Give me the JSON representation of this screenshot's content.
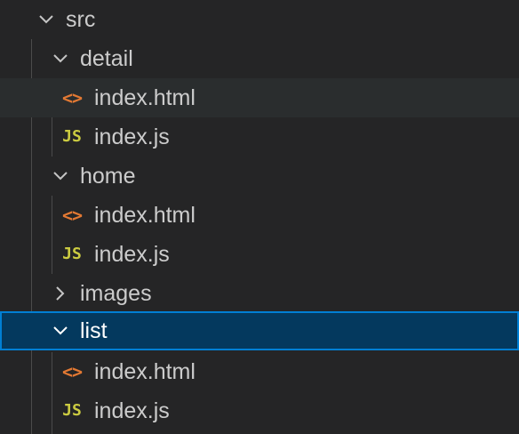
{
  "explorer": {
    "rows": [
      {
        "label": "src",
        "type": "folder",
        "expanded": true
      },
      {
        "label": "detail",
        "type": "folder",
        "expanded": true
      },
      {
        "label": "index.html",
        "type": "file",
        "icon": "<>",
        "icon_name": "html-file-icon"
      },
      {
        "label": "index.js",
        "type": "file",
        "icon": "JS",
        "icon_name": "js-file-icon"
      },
      {
        "label": "home",
        "type": "folder",
        "expanded": true
      },
      {
        "label": "index.html",
        "type": "file",
        "icon": "<>",
        "icon_name": "html-file-icon"
      },
      {
        "label": "index.js",
        "type": "file",
        "icon": "JS",
        "icon_name": "js-file-icon"
      },
      {
        "label": "images",
        "type": "folder",
        "expanded": false
      },
      {
        "label": "list",
        "type": "folder",
        "expanded": true,
        "selected": true
      },
      {
        "label": "index.html",
        "type": "file",
        "icon": "<>",
        "icon_name": "html-file-icon"
      },
      {
        "label": "index.js",
        "type": "file",
        "icon": "JS",
        "icon_name": "js-file-icon"
      }
    ]
  },
  "colors": {
    "background": "#252526",
    "selection": "#04395e",
    "selection_border": "#007fd4",
    "hover": "#2a2d2e",
    "html_icon": "#e37933",
    "js_icon": "#cbcb41",
    "text": "#cccccc"
  }
}
